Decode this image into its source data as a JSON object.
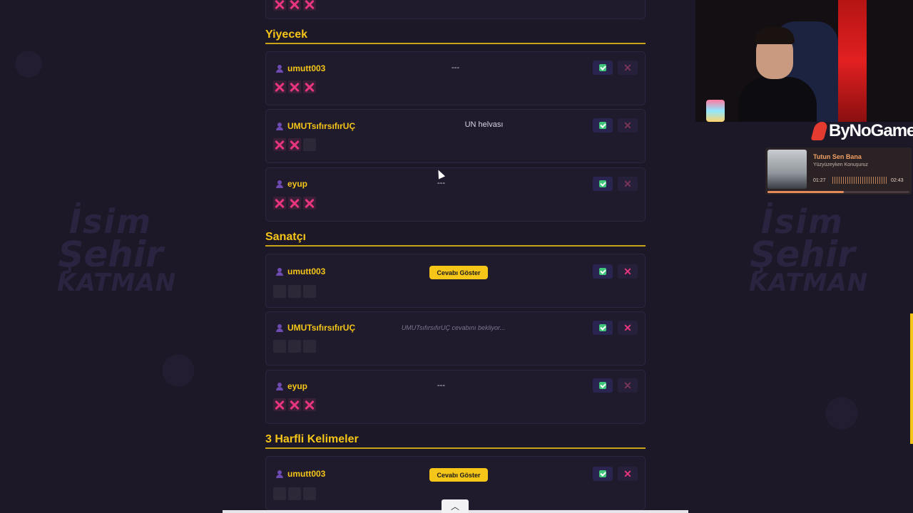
{
  "watermark": {
    "line1": "İsim",
    "line2": "Şehir",
    "line3": "KATMAN"
  },
  "top_votes": [
    "x",
    "x",
    "x"
  ],
  "sections": [
    {
      "title": "Yiyecek",
      "entries": [
        {
          "user": "umutt003",
          "answer": "---",
          "answer_type": "text",
          "votes": [
            "x",
            "x",
            "x"
          ],
          "reject_active": false
        },
        {
          "user": "UMUTsıfırsıfırUÇ",
          "answer": "UN helvası",
          "answer_type": "text",
          "votes": [
            "x",
            "x",
            ""
          ],
          "reject_active": false
        },
        {
          "user": "eyup",
          "answer": "---",
          "answer_type": "text",
          "votes": [
            "x",
            "x",
            "x"
          ],
          "reject_active": false
        }
      ]
    },
    {
      "title": "Sanatçı",
      "entries": [
        {
          "user": "umutt003",
          "answer": "Cevabı Göster",
          "answer_type": "button",
          "votes": [
            "",
            "",
            ""
          ],
          "reject_active": true
        },
        {
          "user": "UMUTsıfırsıfırUÇ",
          "answer": "UMUTsıfırsıfırUÇ cevabını bekliyor...",
          "answer_type": "waiting",
          "votes": [
            "",
            "",
            ""
          ],
          "reject_active": true
        },
        {
          "user": "eyup",
          "answer": "---",
          "answer_type": "text",
          "votes": [
            "x",
            "x",
            "x"
          ],
          "reject_active": false
        }
      ]
    },
    {
      "title": "3 Harfli Kelimeler",
      "entries": [
        {
          "user": "umutt003",
          "answer": "Cevabı Göster",
          "answer_type": "button",
          "votes": [
            "",
            "",
            ""
          ],
          "reject_active": true
        }
      ]
    }
  ],
  "overlay": {
    "brand": "ByNoGame",
    "player": {
      "song": "Tutun Sen Bana",
      "artist": "Yüzyüzeyken Konuşuruz",
      "elapsed": "01:27",
      "duration": "02:43",
      "progress": 0.54
    }
  },
  "icons": {
    "user": "user-icon",
    "approve": "check-icon",
    "reject": "close-icon",
    "scroll_up": "chevron-up-icon"
  },
  "colors": {
    "accent": "#f5c518",
    "reject": "#e8357e",
    "approve": "#3fc67a",
    "background": "#1c1828"
  }
}
